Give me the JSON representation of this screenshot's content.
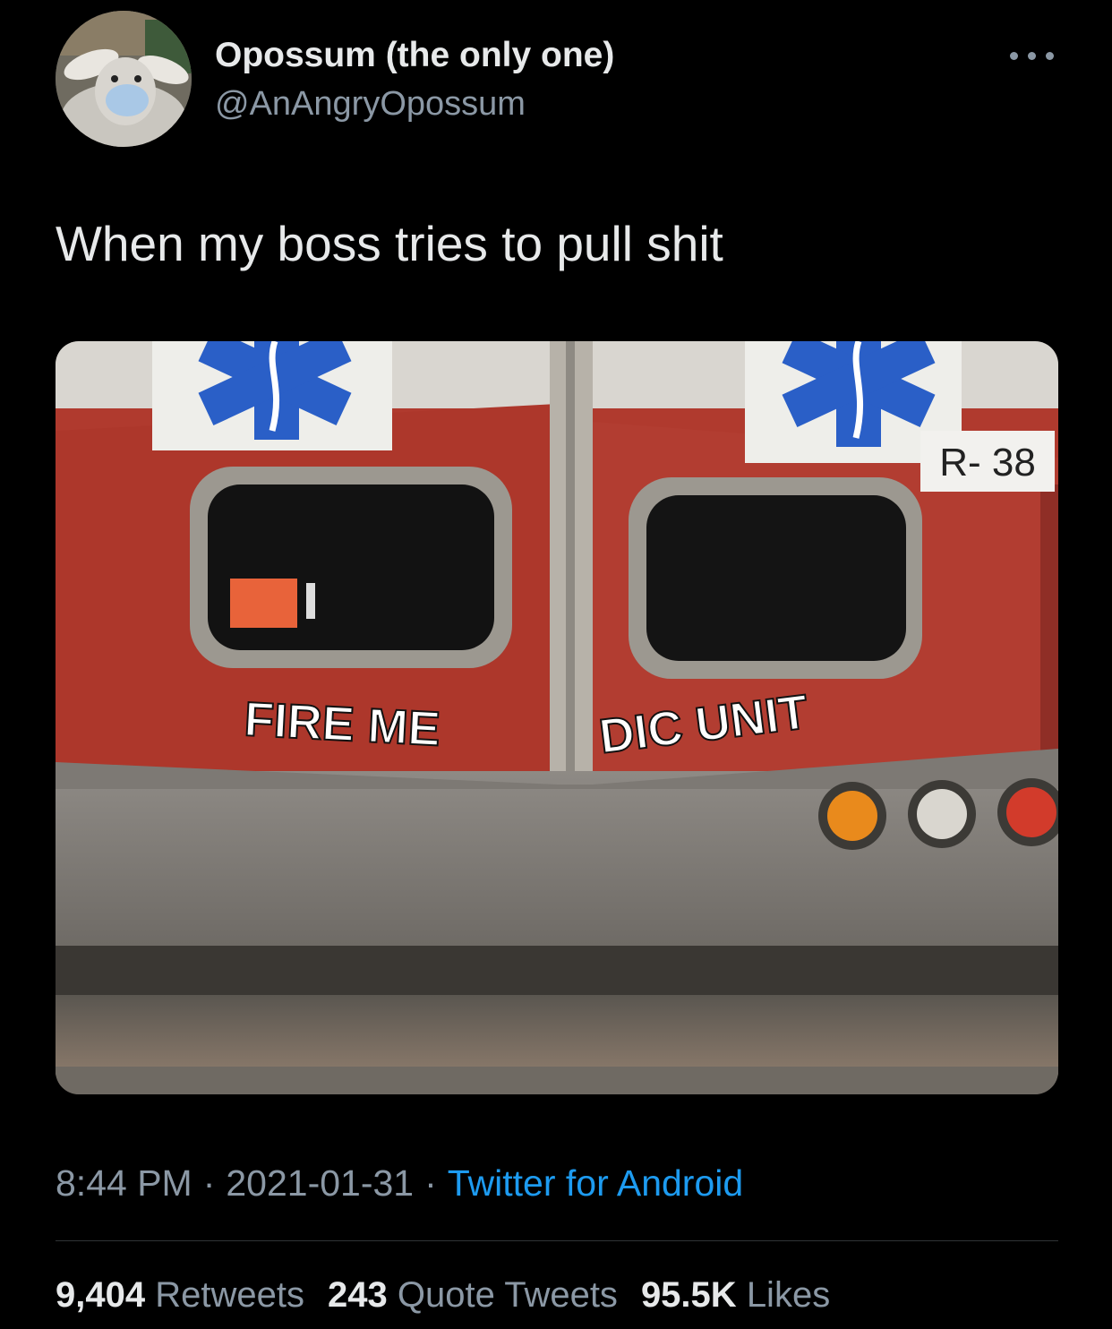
{
  "author": {
    "display_name": "Opossum (the only one)",
    "handle": "@AnAngryOpossum"
  },
  "tweet": {
    "text": "When my boss tries to pull shit",
    "image": {
      "door_lettering_left": "FIRE ME",
      "door_lettering_right": "DIC UNIT",
      "unit_number": "R- 38"
    }
  },
  "meta": {
    "time": "8:44 PM",
    "separator": "·",
    "date": "2021-01-31",
    "source": "Twitter for Android"
  },
  "stats": {
    "retweets_count": "9,404",
    "retweets_label": "Retweets",
    "quotes_count": "243",
    "quotes_label": "Quote Tweets",
    "likes_count": "95.5K",
    "likes_label": "Likes"
  },
  "icons": {
    "more": "more-options-icon",
    "star_of_life": "star-of-life-icon"
  },
  "colors": {
    "background": "#000000",
    "primary_text": "#e7e9ea",
    "secondary_text": "#8b98a5",
    "link": "#1d9bf0",
    "ambulance_red": "#b03a2e",
    "emblem_blue": "#2a5fc7"
  }
}
